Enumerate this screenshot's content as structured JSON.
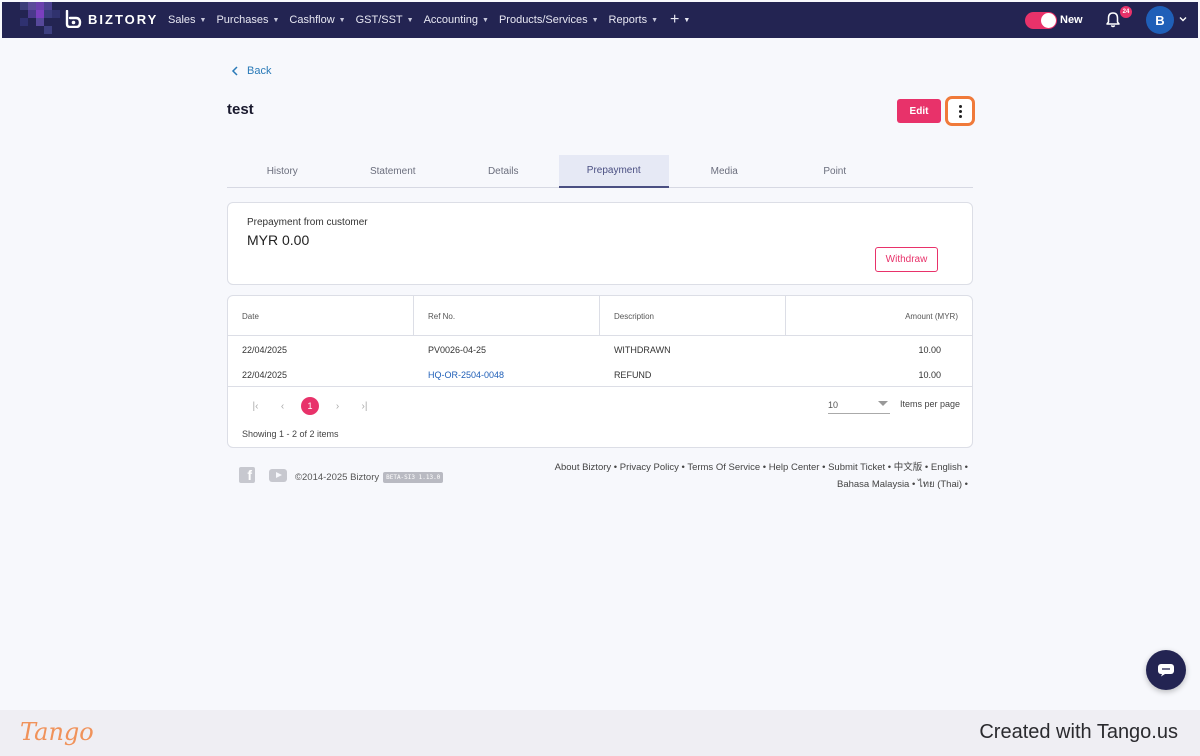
{
  "nav": {
    "brand": "BIZTORY",
    "menu": [
      {
        "label": "Sales"
      },
      {
        "label": "Purchases"
      },
      {
        "label": "Cashflow"
      },
      {
        "label": "GST/SST"
      },
      {
        "label": "Accounting"
      },
      {
        "label": "Products/Services"
      },
      {
        "label": "Reports"
      }
    ],
    "plus_icon": "plus-icon",
    "toggle_label": "New",
    "notification_count": "24",
    "avatar_initial": "B",
    "colors": {
      "nav_bg": "#232452",
      "accent": "#e8326a",
      "avatar": "#1f5fb8"
    }
  },
  "page": {
    "back_label": "Back",
    "title": "test",
    "edit_label": "Edit",
    "more_icon": "more-vertical-icon"
  },
  "tabs": [
    {
      "label": "History",
      "active": false
    },
    {
      "label": "Statement",
      "active": false
    },
    {
      "label": "Details",
      "active": false
    },
    {
      "label": "Prepayment",
      "active": true
    },
    {
      "label": "Media",
      "active": false
    },
    {
      "label": "Point",
      "active": false
    }
  ],
  "prepayment": {
    "label": "Prepayment from customer",
    "amount": "MYR 0.00",
    "withdraw_label": "Withdraw"
  },
  "table": {
    "headers": [
      "Date",
      "Ref No.",
      "Description",
      "Amount (MYR)"
    ],
    "rows": [
      {
        "date": "22/04/2025",
        "ref": "PV0026-04-25",
        "description": "WITHDRAWN",
        "amount": "10.00"
      },
      {
        "date": "22/04/2025",
        "ref": "HQ-OR-2504-0048",
        "description": "REFUND",
        "amount": "10.00"
      }
    ],
    "pagination": {
      "current_page": "1"
    },
    "per_page": "10",
    "per_page_label": "Items per page",
    "showing": "Showing 1 - 2 of 2 items"
  },
  "footer": {
    "copyright": "©2014-2025 Biztory",
    "version_badge": "BETA-SI3 1.13.0",
    "links": [
      "About Biztory",
      "Privacy Policy",
      "Terms Of Service",
      "Help Center",
      "Submit Ticket",
      "中文版",
      "English",
      "Bahasa Malaysia",
      "ไทย (Thai)"
    ],
    "icons": [
      "facebook-icon",
      "youtube-icon"
    ]
  },
  "tango": {
    "logo": "Tango",
    "credit": "Created with Tango.us"
  }
}
